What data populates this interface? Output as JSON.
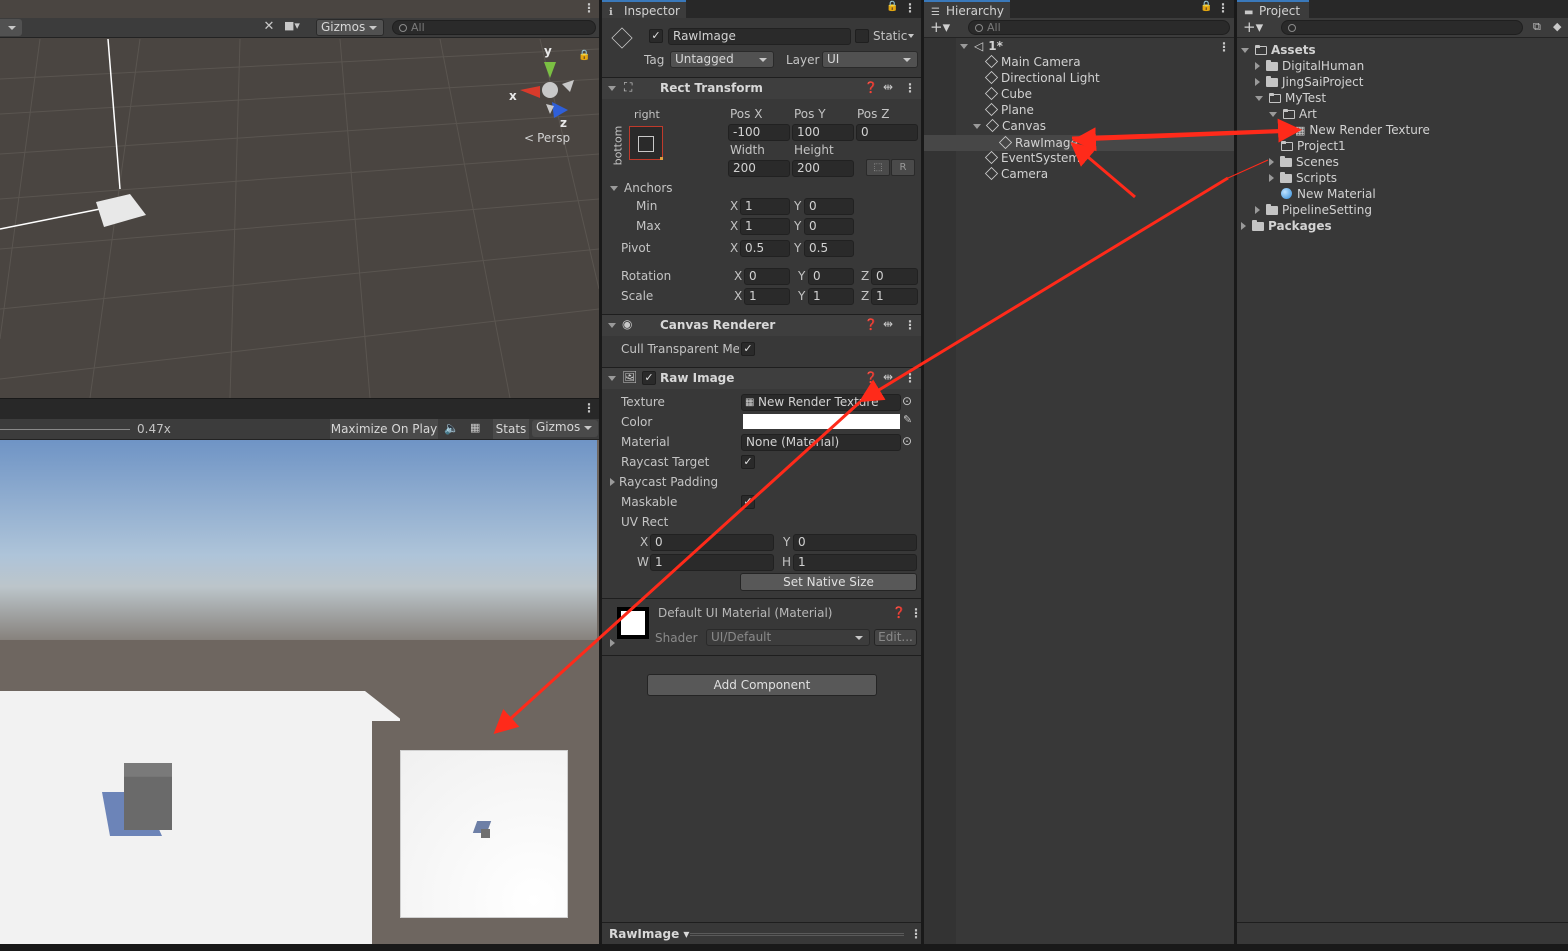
{
  "scene": {
    "toolbar": {
      "gizmos_label": "Gizmos",
      "search_placeholder": "All"
    },
    "gizmo": {
      "axis_y": "y",
      "axis_x": "x",
      "axis_z": "z",
      "projection": "Persp"
    }
  },
  "game": {
    "scale_value": "0.47x",
    "maximize_on_play": "Maximize On Play",
    "stats_label": "Stats",
    "gizmos_label": "Gizmos"
  },
  "inspector": {
    "tab_label": "Inspector",
    "object": {
      "name": "RawImage",
      "static_label": "Static",
      "tag_label": "Tag",
      "tag_value": "Untagged",
      "layer_label": "Layer",
      "layer_value": "UI"
    },
    "rect_transform": {
      "title": "Rect Transform",
      "anchor_preset_top": "right",
      "anchor_preset_side": "bottom",
      "pos_x_label": "Pos X",
      "pos_y_label": "Pos Y",
      "pos_z_label": "Pos Z",
      "pos_x": "-100",
      "pos_y": "100",
      "pos_z": "0",
      "width_label": "Width",
      "height_label": "Height",
      "width": "200",
      "height": "200",
      "r_button": "R",
      "anchors_label": "Anchors",
      "min_label": "Min",
      "max_label": "Max",
      "min_x": "1",
      "min_y": "0",
      "max_x": "1",
      "max_y": "0",
      "pivot_label": "Pivot",
      "pivot_x": "0.5",
      "pivot_y": "0.5",
      "rotation_label": "Rotation",
      "rot_x": "0",
      "rot_y": "0",
      "rot_z": "0",
      "scale_label": "Scale",
      "scale_x": "1",
      "scale_y": "1",
      "scale_z": "1",
      "x": "X",
      "y": "Y",
      "z": "Z"
    },
    "canvas_renderer": {
      "title": "Canvas Renderer",
      "cull_label": "Cull Transparent Mes"
    },
    "raw_image": {
      "title": "Raw Image",
      "texture_label": "Texture",
      "texture_value": "New Render Texture",
      "color_label": "Color",
      "material_label": "Material",
      "material_value": "None (Material)",
      "raycast_target_label": "Raycast Target",
      "raycast_padding_label": "Raycast Padding",
      "maskable_label": "Maskable",
      "uv_rect_label": "UV Rect",
      "uv_x": "0",
      "uv_y": "0",
      "uv_w": "1",
      "uv_h": "1",
      "w": "W",
      "h": "H",
      "set_native_size": "Set Native Size"
    },
    "material_block": {
      "title": "Default UI Material (Material)",
      "shader_label": "Shader",
      "shader_value": "UI/Default",
      "edit_label": "Edit..."
    },
    "add_component": "Add Component",
    "footer_label": "RawImage"
  },
  "hierarchy": {
    "tab_label": "Hierarchy",
    "search_placeholder": "All",
    "scene_name": "1*",
    "items": [
      "Main Camera",
      "Directional Light",
      "Cube",
      "Plane",
      "Canvas",
      "RawImage",
      "EventSystem",
      "Camera"
    ]
  },
  "project": {
    "tab_label": "Project",
    "assets_label": "Assets",
    "items": [
      "DigitalHuman",
      "JingSaiProject",
      "MyTest",
      "Art",
      "New Render Texture",
      "Project1",
      "Scenes",
      "Scripts",
      "New Material",
      "PipelineSetting"
    ],
    "packages_label": "Packages"
  },
  "colors": {
    "annotation_arrow": "#ff2a1a",
    "selection": "#474747",
    "accent": "#3a79bb"
  }
}
